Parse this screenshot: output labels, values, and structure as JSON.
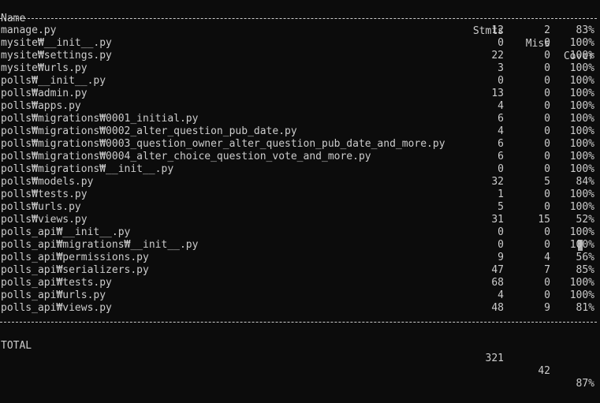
{
  "header": {
    "name": "Name",
    "stmts": "Stmts",
    "miss": "Miss",
    "cover": "Cover"
  },
  "rows": [
    {
      "name": "manage.py",
      "stmts": "12",
      "miss": "2",
      "cover": "83%"
    },
    {
      "name": "mysite₩__init__.py",
      "stmts": "0",
      "miss": "0",
      "cover": "100%"
    },
    {
      "name": "mysite₩settings.py",
      "stmts": "22",
      "miss": "0",
      "cover": "100%"
    },
    {
      "name": "mysite₩urls.py",
      "stmts": "3",
      "miss": "0",
      "cover": "100%"
    },
    {
      "name": "polls₩__init__.py",
      "stmts": "0",
      "miss": "0",
      "cover": "100%"
    },
    {
      "name": "polls₩admin.py",
      "stmts": "13",
      "miss": "0",
      "cover": "100%"
    },
    {
      "name": "polls₩apps.py",
      "stmts": "4",
      "miss": "0",
      "cover": "100%"
    },
    {
      "name": "polls₩migrations₩0001_initial.py",
      "stmts": "6",
      "miss": "0",
      "cover": "100%"
    },
    {
      "name": "polls₩migrations₩0002_alter_question_pub_date.py",
      "stmts": "4",
      "miss": "0",
      "cover": "100%"
    },
    {
      "name": "polls₩migrations₩0003_question_owner_alter_question_pub_date_and_more.py",
      "stmts": "6",
      "miss": "0",
      "cover": "100%"
    },
    {
      "name": "polls₩migrations₩0004_alter_choice_question_vote_and_more.py",
      "stmts": "6",
      "miss": "0",
      "cover": "100%"
    },
    {
      "name": "polls₩migrations₩__init__.py",
      "stmts": "0",
      "miss": "0",
      "cover": "100%"
    },
    {
      "name": "polls₩models.py",
      "stmts": "32",
      "miss": "5",
      "cover": "84%"
    },
    {
      "name": "polls₩tests.py",
      "stmts": "1",
      "miss": "0",
      "cover": "100%"
    },
    {
      "name": "polls₩urls.py",
      "stmts": "5",
      "miss": "0",
      "cover": "100%"
    },
    {
      "name": "polls₩views.py",
      "stmts": "31",
      "miss": "15",
      "cover": "52%"
    },
    {
      "name": "polls_api₩__init__.py",
      "stmts": "0",
      "miss": "0",
      "cover": "100%"
    },
    {
      "name": "polls_api₩migrations₩__init__.py",
      "stmts": "0",
      "miss": "0",
      "cover": "100%"
    },
    {
      "name": "polls_api₩permissions.py",
      "stmts": "9",
      "miss": "4",
      "cover": "56%"
    },
    {
      "name": "polls_api₩serializers.py",
      "stmts": "47",
      "miss": "7",
      "cover": "85%"
    },
    {
      "name": "polls_api₩tests.py",
      "stmts": "68",
      "miss": "0",
      "cover": "100%"
    },
    {
      "name": "polls_api₩urls.py",
      "stmts": "4",
      "miss": "0",
      "cover": "100%"
    },
    {
      "name": "polls_api₩views.py",
      "stmts": "48",
      "miss": "9",
      "cover": "81%"
    }
  ],
  "total": {
    "name": "TOTAL",
    "stmts": "321",
    "miss": "42",
    "cover": "87%"
  },
  "colors": {
    "background": "#0c0c0c",
    "text": "#cccccc"
  }
}
